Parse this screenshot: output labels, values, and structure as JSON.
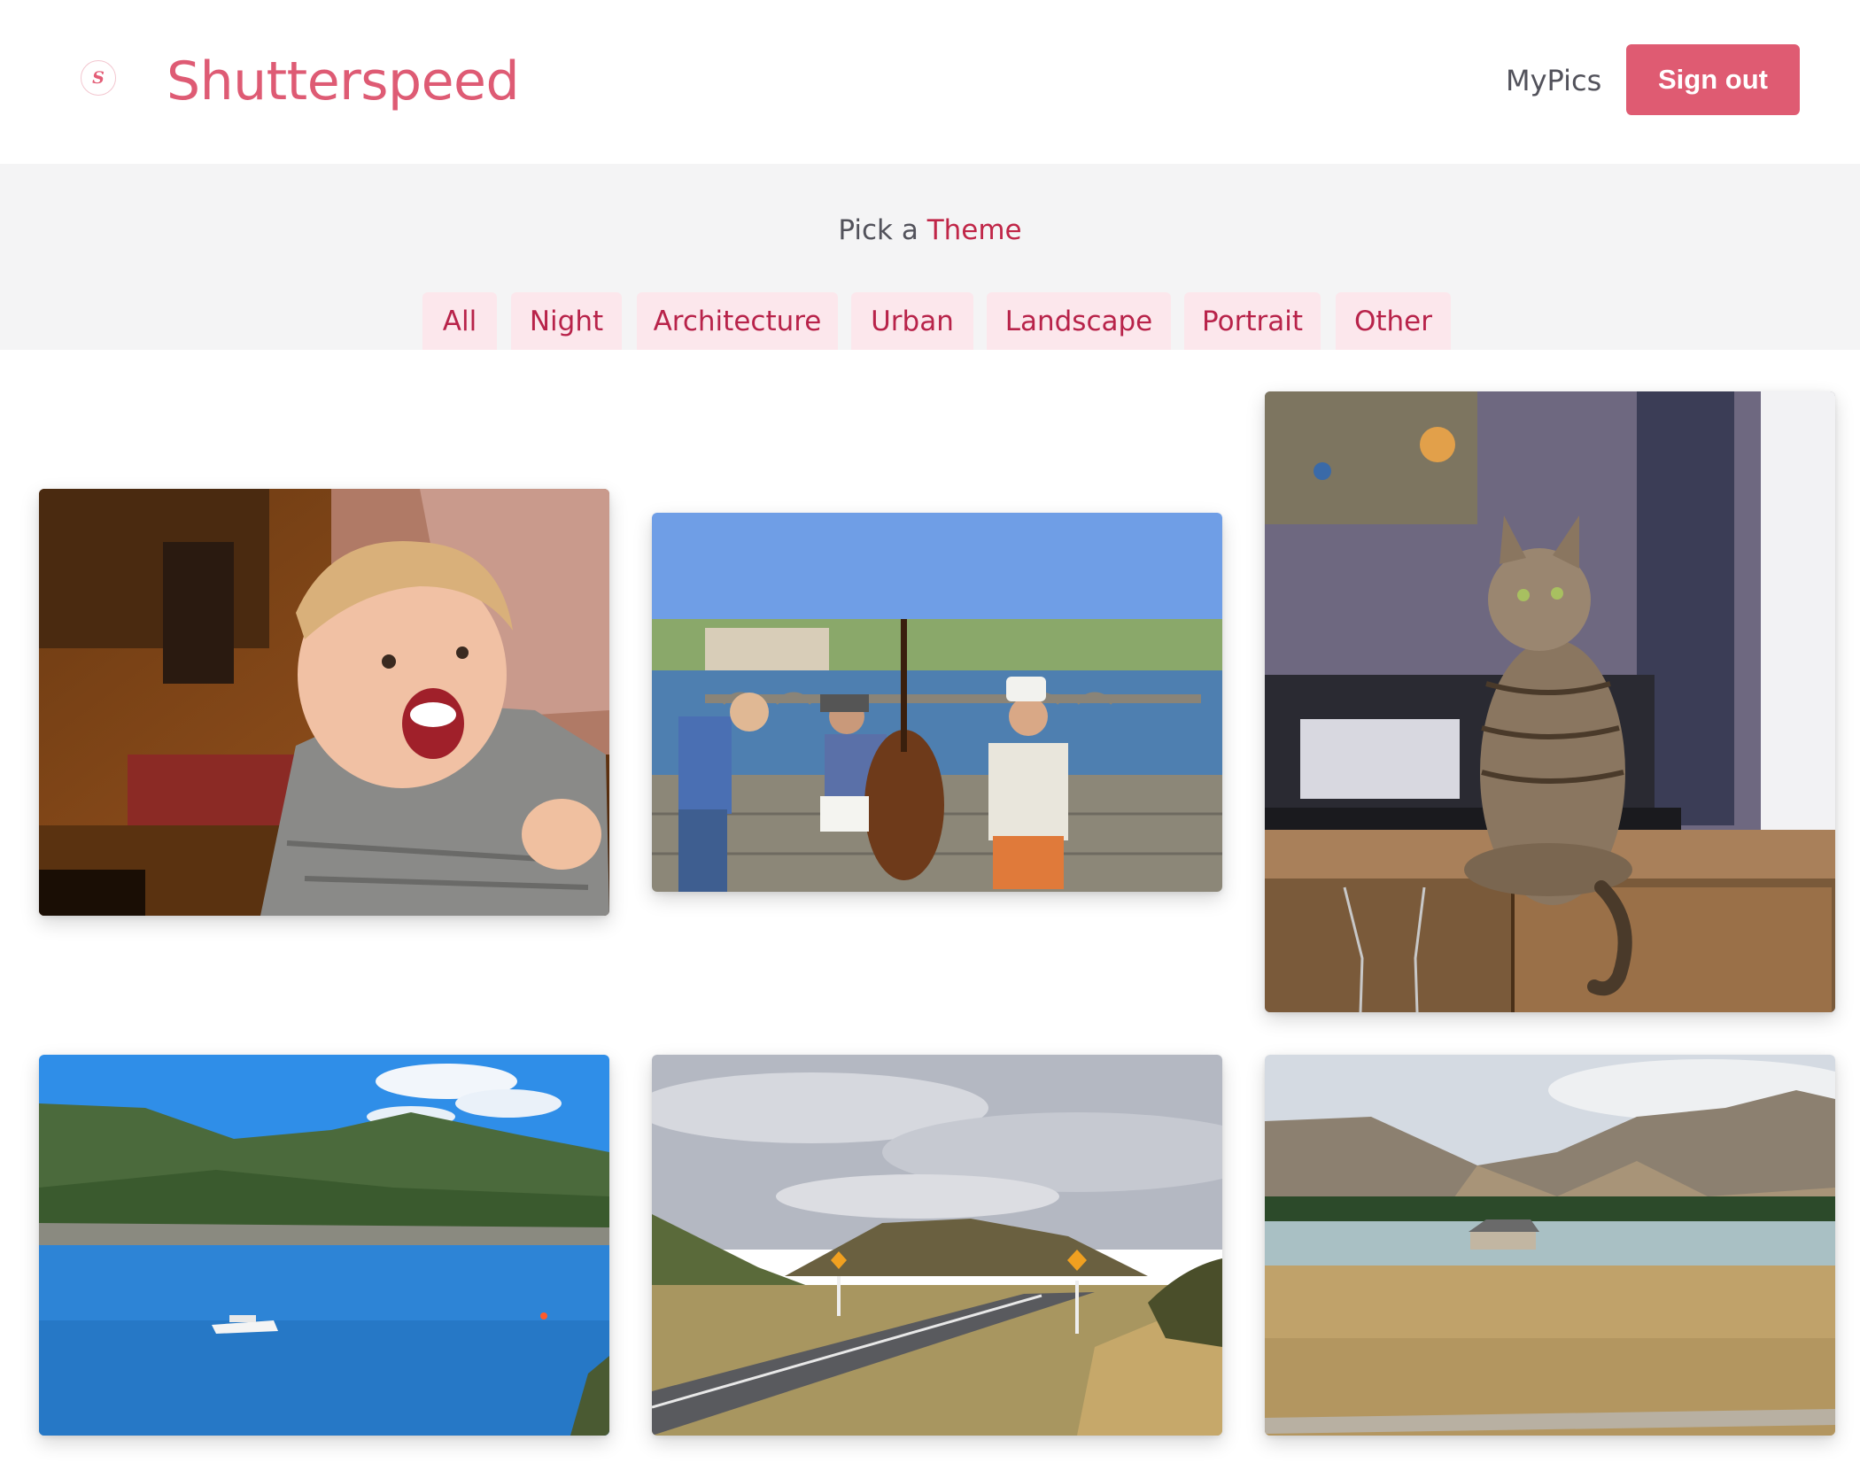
{
  "app": {
    "brand": "Shutterspeed",
    "logo_letter": "S"
  },
  "nav": {
    "mypics_label": "MyPics",
    "signout_label": "Sign out"
  },
  "theme_picker": {
    "prefix": "Pick a ",
    "accent_word": "Theme",
    "tabs": [
      "All",
      "Night",
      "Architecture",
      "Urban",
      "Landscape",
      "Portrait",
      "Other"
    ]
  },
  "colors": {
    "brand": "#de5b74",
    "button": "#df5b72",
    "tab_bg": "#fce7ec",
    "tab_text": "#b8234a",
    "band_bg": "#f4f4f5"
  },
  "gallery": {
    "photos": [
      {
        "subject": "laughing toddler"
      },
      {
        "subject": "street musicians on a bridge"
      },
      {
        "subject": "tabby cat on a cabinet"
      },
      {
        "subject": "boat on a blue lake"
      },
      {
        "subject": "country road"
      },
      {
        "subject": "lake and mountains with a chapel"
      }
    ]
  }
}
